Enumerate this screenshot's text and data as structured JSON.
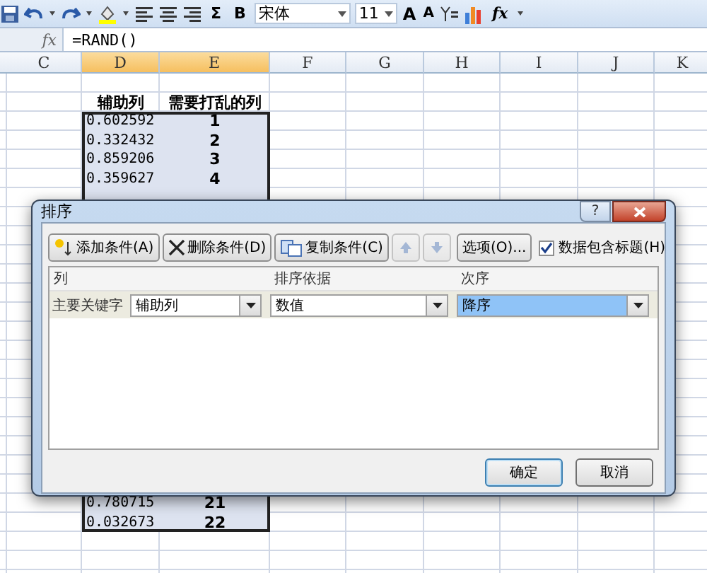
{
  "toolbar": {
    "items": [
      {
        "kind": "save"
      },
      {
        "kind": "undo"
      },
      {
        "kind": "caret"
      },
      {
        "kind": "redo"
      },
      {
        "kind": "caret"
      },
      {
        "kind": "fill"
      },
      {
        "kind": "caret"
      },
      {
        "kind": "align-left"
      },
      {
        "kind": "align-center"
      },
      {
        "kind": "align-right"
      },
      {
        "kind": "text",
        "label": "Σ"
      },
      {
        "kind": "text",
        "label": "B"
      },
      {
        "kind": "font",
        "value": "宋体"
      },
      {
        "kind": "size",
        "value": "11"
      },
      {
        "kind": "grow-font",
        "label": "A"
      },
      {
        "kind": "shrink-font",
        "label": "A"
      },
      {
        "kind": "sort"
      },
      {
        "kind": "chart"
      },
      {
        "kind": "text",
        "label": "fx"
      },
      {
        "kind": "more"
      }
    ]
  },
  "formula_bar": {
    "function_label": "fx",
    "formula": "=RAND()"
  },
  "sheet": {
    "columns": [
      {
        "label": "C",
        "selected": false
      },
      {
        "label": "D",
        "selected": true
      },
      {
        "label": "E",
        "selected": true
      },
      {
        "label": "F",
        "selected": false
      },
      {
        "label": "G",
        "selected": false
      },
      {
        "label": "H",
        "selected": false
      },
      {
        "label": "I",
        "selected": false
      },
      {
        "label": "J",
        "selected": false
      },
      {
        "label": "K",
        "selected": false
      }
    ],
    "rows_top": [
      {
        "kind": "header",
        "column_d": "辅助列",
        "column_e": "需要打乱的列"
      },
      {
        "kind": "data",
        "column_d": "0.602592",
        "column_e": "1"
      },
      {
        "kind": "data",
        "column_d": "0.332432",
        "column_e": "2"
      },
      {
        "kind": "data",
        "column_d": "0.859206",
        "column_e": "3"
      },
      {
        "kind": "data",
        "column_d": "0.359627",
        "column_e": "4"
      }
    ],
    "rows_bottom": [
      {
        "kind": "data",
        "column_d": "0.780715",
        "column_e": "21"
      },
      {
        "kind": "data",
        "column_d": "0.032673",
        "column_e": "22"
      }
    ]
  },
  "dialog": {
    "title": "排序",
    "help_label": "?",
    "toolbar": [
      {
        "kind": "add",
        "label": "添加条件(A)",
        "disabled": false
      },
      {
        "kind": "delete",
        "label": "删除条件(D)",
        "disabled": false
      },
      {
        "kind": "copy",
        "label": "复制条件(C)",
        "disabled": false
      },
      {
        "kind": "up",
        "disabled": true
      },
      {
        "kind": "down",
        "disabled": true
      },
      {
        "kind": "options",
        "label": "选项(O)...",
        "disabled": false
      }
    ],
    "header_checkbox": {
      "label": "数据包含标题(H)",
      "checked": true
    },
    "columns": [
      "列",
      "排序依据",
      "次序"
    ],
    "rows": [
      {
        "label": "主要关键字",
        "fields": [
          {
            "value": "辅助列",
            "focused": false
          },
          {
            "value": "数值",
            "focused": false
          },
          {
            "value": "降序",
            "focused": true
          }
        ]
      }
    ],
    "buttons": [
      {
        "label": "确定",
        "default": true
      },
      {
        "label": "取消",
        "default": false
      }
    ]
  }
}
